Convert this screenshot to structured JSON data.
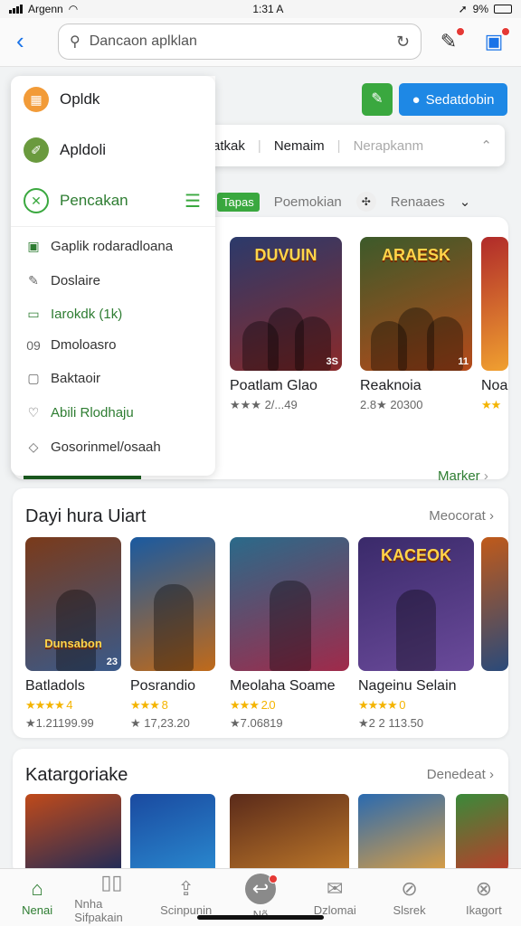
{
  "status": {
    "carrier": "Argenn",
    "time": "1:31 A",
    "battery": "9%"
  },
  "search": {
    "placeholder": "Dancaon aplklan"
  },
  "drawer": {
    "main_items": [
      {
        "label": "Opldk",
        "color": "#f29b38"
      },
      {
        "label": "Apldoli",
        "color": "#6a9a3e"
      },
      {
        "label": "Pencakan",
        "color": "#3aa83f"
      }
    ],
    "sub_items": [
      {
        "label": "Gaplik rodaradloana",
        "icon": "grid-icon"
      },
      {
        "label": "Doslaire",
        "icon": "pencil-icon"
      },
      {
        "label": "Iarokdk (1k)",
        "icon": "card-icon"
      },
      {
        "label": "Dmoloasro",
        "icon": "number-icon"
      },
      {
        "label": "Baktaoir",
        "icon": "chat-icon"
      },
      {
        "label": "Abili Rlodhaju",
        "icon": "heart-icon"
      },
      {
        "label": "Gosorinmel/osaah",
        "icon": "gear-icon"
      }
    ],
    "close_label": "[X"
  },
  "filter": {
    "items": [
      "Renbatkak",
      "Nemaim",
      "Nerapkanm"
    ]
  },
  "header_buttons": {
    "blue_label": "Sedatdobin"
  },
  "tabs": [
    "Tapas",
    "Poemokian",
    "Renaaes"
  ],
  "featured": {
    "more": "Marker",
    "games": [
      {
        "title": "Poatlam Glao",
        "meta": "★★★ 2/...49",
        "logo": "DUVUIN",
        "age": "3S",
        "c1": "#2b3a6b",
        "c2": "#8a2a2a"
      },
      {
        "title": "Reaknoia",
        "meta": "2.8★ 20300",
        "logo": "ARAESK",
        "age": "11",
        "c1": "#3c5a2a",
        "c2": "#b54a1a"
      },
      {
        "title": "Noa",
        "meta": "★★",
        "logo": "",
        "age": "",
        "c1": "#b02a2a",
        "c2": "#f0a030"
      }
    ]
  },
  "popular": {
    "title": "Dayi hura Uiart",
    "more": "Meocorat",
    "games": [
      {
        "title": "Batladols",
        "stars": "★★★★ 4",
        "meta": "★1.21199.99",
        "logo": "Dunsabon",
        "age": "23",
        "c1": "#7a3a1a",
        "c2": "#3a5a8a"
      },
      {
        "title": "Posrandio",
        "stars": "★★★ 8",
        "meta": "★ 17,23.20",
        "logo": "",
        "age": "",
        "c1": "#1a5aa0",
        "c2": "#c06a1a"
      },
      {
        "title": "Meolaha Soame",
        "stars": "★★★ 2.0",
        "meta": "★7.06819",
        "logo": "",
        "age": "",
        "c1": "#2a6a8a",
        "c2": "#a02a4a"
      },
      {
        "title": "Nageinu Selain",
        "stars": "★★★★ 0",
        "meta": "★2 2 113.50",
        "logo": "KACEOK",
        "age": "",
        "c1": "#3a2a6a",
        "c2": "#6a4a9a"
      },
      {
        "title": "",
        "stars": "",
        "meta": "",
        "logo": "",
        "age": "",
        "c1": "#c05a1a",
        "c2": "#2a4a7a"
      }
    ]
  },
  "categories": {
    "title": "Katargoriake",
    "more": "Denedeat",
    "thumbs": [
      {
        "c1": "#c04a1a",
        "c2": "#1a2a5a"
      },
      {
        "c1": "#1a4aa0",
        "c2": "#2a8ad0"
      },
      {
        "c1": "#5a2a1a",
        "c2": "#c07a2a"
      },
      {
        "c1": "#2a6ab0",
        "c2": "#e0a040"
      },
      {
        "c1": "#3a8a3a",
        "c2": "#c03a2a"
      }
    ]
  },
  "nav": [
    {
      "label": "Nenai",
      "icon": "home-icon",
      "glyph": "⌂",
      "active": true
    },
    {
      "label": "Nnha Sifpakain",
      "icon": "apps-icon",
      "glyph": "▯▯",
      "active": false
    },
    {
      "label": "Scinpunin",
      "icon": "upload-icon",
      "glyph": "⇪",
      "active": false
    },
    {
      "label": "Nõ",
      "icon": "share-icon",
      "glyph": "↩",
      "active": false
    },
    {
      "label": "Dzlomai",
      "icon": "mail-icon",
      "glyph": "✉",
      "active": false
    },
    {
      "label": "Slsrek",
      "icon": "compass-icon",
      "glyph": "⊘",
      "active": false
    },
    {
      "label": "Ikagort",
      "icon": "cancel-icon",
      "glyph": "⊗",
      "active": false
    }
  ]
}
